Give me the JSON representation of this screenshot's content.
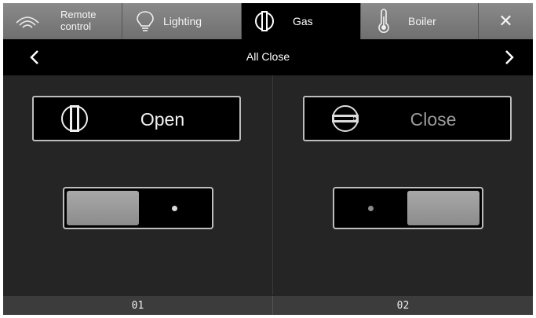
{
  "tabs": {
    "remote": {
      "label_line1": "Remote",
      "label_line2": "control",
      "icon": "wifi-signal-icon"
    },
    "lighting": {
      "label": "Lighting",
      "icon": "light-bulb-icon"
    },
    "gas": {
      "label": "Gas",
      "icon": "gas-valve-icon",
      "active": true
    },
    "boiler": {
      "label": "Boiler",
      "icon": "thermometer-icon"
    },
    "close": {
      "label": "✕",
      "icon": "close-icon"
    }
  },
  "titlebar": {
    "title": "All Close",
    "left_icon": "chevron-left-icon",
    "right_icon": "chevron-right-icon"
  },
  "valves": [
    {
      "number": "01",
      "state_label": "Open",
      "state_icon": "valve-open-icon",
      "toggle": "open"
    },
    {
      "number": "02",
      "state_label": "Close",
      "state_icon": "valve-closed-icon",
      "toggle": "closed"
    }
  ],
  "colors": {
    "active_tab": "#000000",
    "inactive_tab": "#7c7c7c",
    "background": "#252525",
    "footer": "#3c3c3c"
  }
}
